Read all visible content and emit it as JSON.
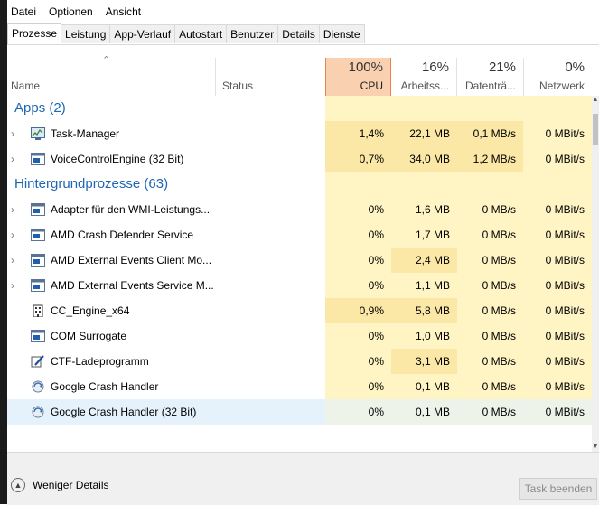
{
  "menu": [
    "Datei",
    "Optionen",
    "Ansicht"
  ],
  "tabs": [
    "Prozesse",
    "Leistung",
    "App-Verlauf",
    "Autostart",
    "Benutzer",
    "Details",
    "Dienste"
  ],
  "active_tab": "Prozesse",
  "columns": {
    "name": "Name",
    "status": "Status",
    "cpu": {
      "pct": "100%",
      "label": "CPU"
    },
    "memory": {
      "pct": "16%",
      "label": "Arbeitss..."
    },
    "disk": {
      "pct": "21%",
      "label": "Datenträ..."
    },
    "network": {
      "pct": "0%",
      "label": "Netzwerk"
    }
  },
  "groups": [
    {
      "title": "Apps (2)",
      "rows": [
        {
          "name": "Task-Manager",
          "icon": "task-manager-icon",
          "expandable": true,
          "cpu": "1,4%",
          "mem": "22,1 MB",
          "disk": "0,1 MB/s",
          "net": "0 MBit/s"
        },
        {
          "name": "VoiceControlEngine (32 Bit)",
          "icon": "window-icon",
          "expandable": true,
          "cpu": "0,7%",
          "mem": "34,0 MB",
          "disk": "1,2 MB/s",
          "net": "0 MBit/s"
        }
      ]
    },
    {
      "title": "Hintergrundprozesse (63)",
      "rows": [
        {
          "name": "Adapter für den WMI-Leistungs...",
          "icon": "window-icon",
          "expandable": true,
          "cpu": "0%",
          "mem": "1,6 MB",
          "disk": "0 MB/s",
          "net": "0 MBit/s"
        },
        {
          "name": "AMD Crash Defender Service",
          "icon": "window-icon",
          "expandable": true,
          "cpu": "0%",
          "mem": "1,7 MB",
          "disk": "0 MB/s",
          "net": "0 MBit/s"
        },
        {
          "name": "AMD External Events Client Mo...",
          "icon": "window-icon",
          "expandable": true,
          "cpu": "0%",
          "mem": "2,4 MB",
          "disk": "0 MB/s",
          "net": "0 MBit/s"
        },
        {
          "name": "AMD External Events Service M...",
          "icon": "window-icon",
          "expandable": true,
          "cpu": "0%",
          "mem": "1,1 MB",
          "disk": "0 MB/s",
          "net": "0 MBit/s"
        },
        {
          "name": "CC_Engine_x64",
          "icon": "building-icon",
          "expandable": false,
          "cpu": "0,9%",
          "mem": "5,8 MB",
          "disk": "0 MB/s",
          "net": "0 MBit/s"
        },
        {
          "name": "COM Surrogate",
          "icon": "window-icon",
          "expandable": false,
          "cpu": "0%",
          "mem": "1,0 MB",
          "disk": "0 MB/s",
          "net": "0 MBit/s"
        },
        {
          "name": "CTF-Ladeprogramm",
          "icon": "pen-icon",
          "expandable": false,
          "cpu": "0%",
          "mem": "3,1 MB",
          "disk": "0 MB/s",
          "net": "0 MBit/s"
        },
        {
          "name": "Google Crash Handler",
          "icon": "google-update-icon",
          "expandable": false,
          "cpu": "0%",
          "mem": "0,1 MB",
          "disk": "0 MB/s",
          "net": "0 MBit/s"
        },
        {
          "name": "Google Crash Handler (32 Bit)",
          "icon": "google-update-icon",
          "expandable": false,
          "selected": true,
          "cpu": "0%",
          "mem": "0,1 MB",
          "disk": "0 MB/s",
          "net": "0 MBit/s"
        }
      ]
    }
  ],
  "footer": {
    "fewer_details": "Weniger Details",
    "end_task": "Task beenden"
  },
  "colors": {
    "group_title": "#1e66b5",
    "cpu_header": "#f9d0b0",
    "cpu_border": "#e7884a",
    "heat_light": "#fff4c4",
    "heat_medium": "#fbe8a6",
    "selected_row": "#e5f1fb"
  }
}
